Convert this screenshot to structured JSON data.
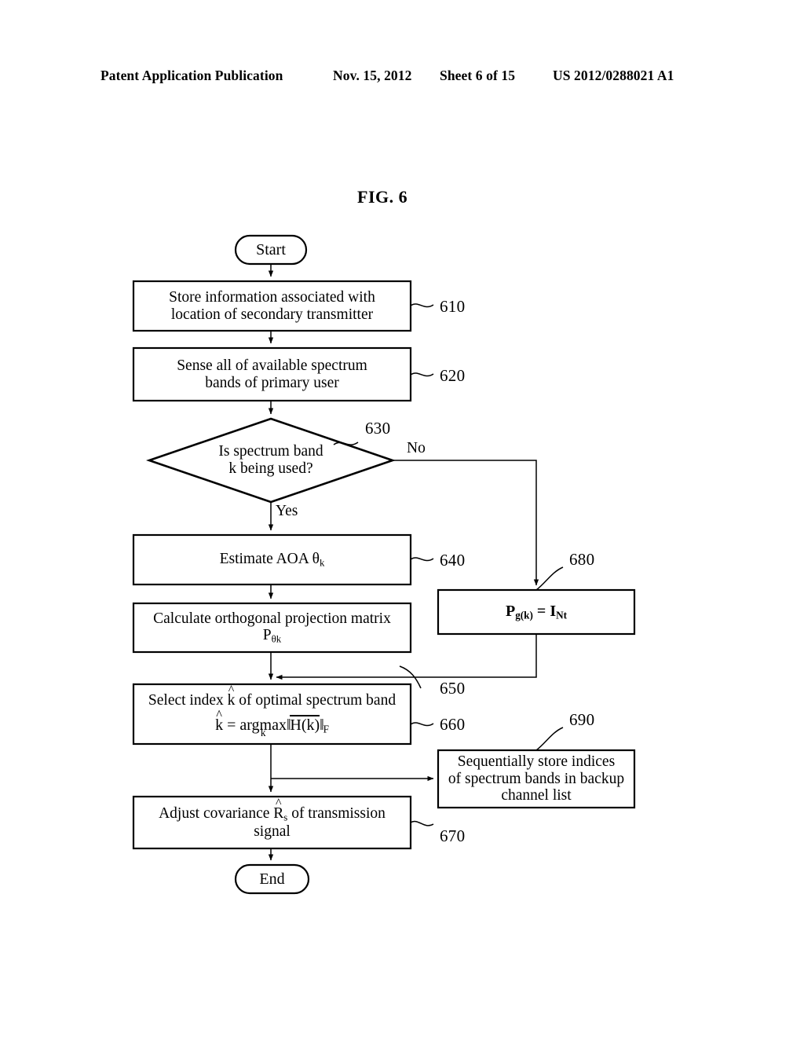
{
  "header": {
    "publication": "Patent Application Publication",
    "date": "Nov. 15, 2012",
    "sheet": "Sheet 6 of 15",
    "patent_number": "US 2012/0288021 A1"
  },
  "figure": {
    "label": "FIG. 6"
  },
  "flowchart": {
    "start_label": "Start",
    "end_label": "End",
    "branch_yes": "Yes",
    "branch_no": "No",
    "nodes": [
      {
        "ref": "610",
        "line1": "Store information associated with",
        "line2": "location of secondary transmitter"
      },
      {
        "ref": "620",
        "line1": "Sense all of available spectrum",
        "line2": "bands of primary user"
      },
      {
        "ref": "630",
        "line1": "Is spectrum band",
        "line2": "k being used?"
      },
      {
        "ref": "640",
        "line1": "Estimate AOA θ",
        "sub1": "k"
      },
      {
        "ref": "650",
        "line1": "Calculate orthogonal projection matrix",
        "line2": "P",
        "sub2": "θk"
      },
      {
        "ref": "660",
        "line1_a": "Select index ",
        "line1_hat": "^",
        "line1_k": "k",
        "line1_b": " of optimal spectrum band",
        "formula_lhs": "k",
        "formula_eq": "=",
        "formula_op": "argmax",
        "formula_opsub": "k",
        "formula_norm": "H(k)",
        "formula_normsub": "F"
      },
      {
        "ref": "670",
        "line1_a": "Adjust covariance ",
        "line1_hat": "^",
        "line1_R": "R",
        "line1_Rsub": "s",
        "line1_b": " of transmission",
        "line2": "signal"
      },
      {
        "ref": "680",
        "formula_P": "P",
        "formula_Psub": "g(k)",
        "formula_eq": "=",
        "formula_I": "I",
        "formula_Isub": "Nt"
      },
      {
        "ref": "690",
        "line1": "Sequentially store indices",
        "line2": "of spectrum bands in backup",
        "line3": "channel list"
      }
    ]
  },
  "colors": {
    "ink": "#000000",
    "paper": "#ffffff"
  }
}
